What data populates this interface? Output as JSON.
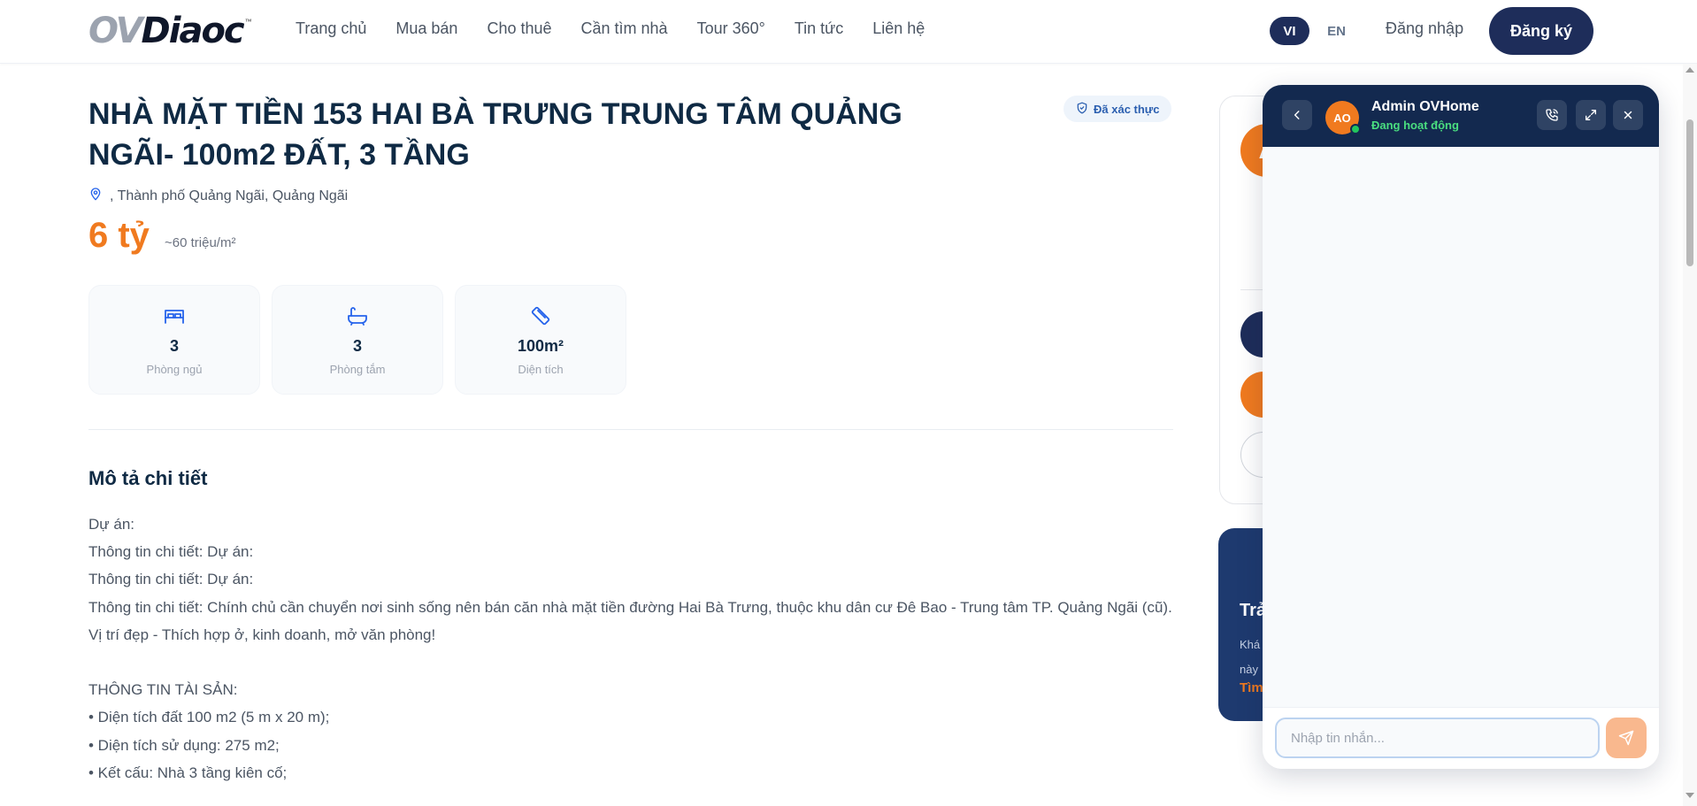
{
  "header": {
    "logo": "OVDiaoc",
    "nav": [
      "Trang chủ",
      "Mua bán",
      "Cho thuê",
      "Cần tìm nhà",
      "Tour 360°",
      "Tin tức",
      "Liên hệ"
    ],
    "lang_vi": "VI",
    "lang_en": "EN",
    "login": "Đăng nhập",
    "register": "Đăng ký"
  },
  "listing": {
    "title": "NHÀ MẶT TIỀN 153 HAI BÀ TRƯNG TRUNG TÂM QUẢNG NGÃI- 100m2 ĐẤT, 3 TẦNG",
    "verified": "Đã xác thực",
    "location": ", Thành phố Quảng Ngãi, Quảng Ngãi",
    "price": "6 tỷ",
    "unit_price": "~60 triệu/m²",
    "specs": [
      {
        "value": "3",
        "label": "Phòng ngủ",
        "icon": "bed-icon"
      },
      {
        "value": "3",
        "label": "Phòng tắm",
        "icon": "bathtub-icon"
      },
      {
        "value": "100m²",
        "label": "Diện tích",
        "icon": "ruler-icon"
      }
    ]
  },
  "description": {
    "title": "Mô tả chi tiết",
    "lines": [
      "Dự án:",
      "Thông tin chi tiết: Dự án:",
      "Thông tin chi tiết: Dự án:",
      "Thông tin chi tiết: Chính chủ cần chuyển nơi sinh sống nên bán căn nhà mặt tiền đường Hai Bà Trưng, thuộc khu dân cư Đê Bao - Trung tâm TP. Quảng Ngãi (cũ).",
      "Vị trí đẹp - Thích hợp ở, kinh doanh, mở văn phòng!",
      "",
      "THÔNG TIN TÀI SẢN:",
      "• Diện tích đất 100 m2 (5 m x 20 m);",
      "• Diện tích sử dụng: 275 m2;",
      "• Kết cấu: Nhà 3 tầng kiên cố;"
    ]
  },
  "sidebar": {
    "avatar_initial": "A",
    "promo_title": "Trả",
    "promo_text": "Khá\nnày",
    "promo_link": "Tìm"
  },
  "chat": {
    "avatar_initials": "AO",
    "name": "Admin OVHome",
    "status": "Đang hoạt động",
    "input_placeholder": "Nhập tin nhắn..."
  },
  "colors": {
    "navy": "#1e2d5a",
    "orange": "#f07a1f",
    "chat_header": "#13294f",
    "online_green": "#22c55e"
  }
}
